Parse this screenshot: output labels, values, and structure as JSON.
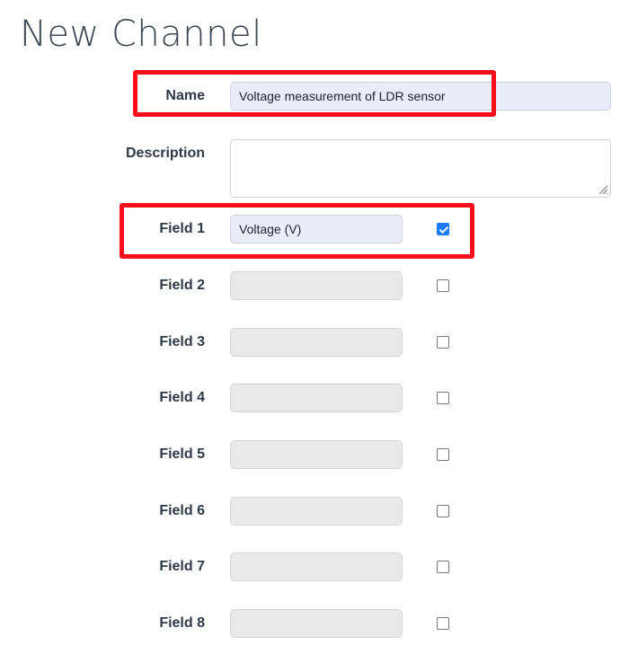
{
  "page": {
    "title": "New Channel"
  },
  "form": {
    "name": {
      "label": "Name",
      "value": "Voltage measurement of LDR sensor",
      "placeholder": ""
    },
    "description": {
      "label": "Description",
      "value": "",
      "placeholder": ""
    },
    "fields": [
      {
        "label": "Field 1",
        "value": "Voltage (V)",
        "placeholder": "",
        "checked": true,
        "disabled": false
      },
      {
        "label": "Field 2",
        "value": "",
        "placeholder": "",
        "checked": false,
        "disabled": true
      },
      {
        "label": "Field 3",
        "value": "",
        "placeholder": "",
        "checked": false,
        "disabled": true
      },
      {
        "label": "Field 4",
        "value": "",
        "placeholder": "",
        "checked": false,
        "disabled": true
      },
      {
        "label": "Field 5",
        "value": "",
        "placeholder": "",
        "checked": false,
        "disabled": true
      },
      {
        "label": "Field 6",
        "value": "",
        "placeholder": "",
        "checked": false,
        "disabled": true
      },
      {
        "label": "Field 7",
        "value": "",
        "placeholder": "",
        "checked": false,
        "disabled": true
      },
      {
        "label": "Field 8",
        "value": "",
        "placeholder": "",
        "checked": false,
        "disabled": true
      }
    ]
  },
  "annotations": [
    {
      "name": "name-row-highlight",
      "color": "#fc0d1b"
    },
    {
      "name": "field1-row-highlight",
      "color": "#fc0d1b"
    }
  ],
  "colors": {
    "accent_blue": "#1a7af8",
    "active_input_bg": "#e8edf9",
    "disabled_input_bg": "#e9e9e9",
    "annotation_red": "#fc0d1b",
    "label_text": "#2f3a49",
    "title_text": "#3d4852"
  }
}
